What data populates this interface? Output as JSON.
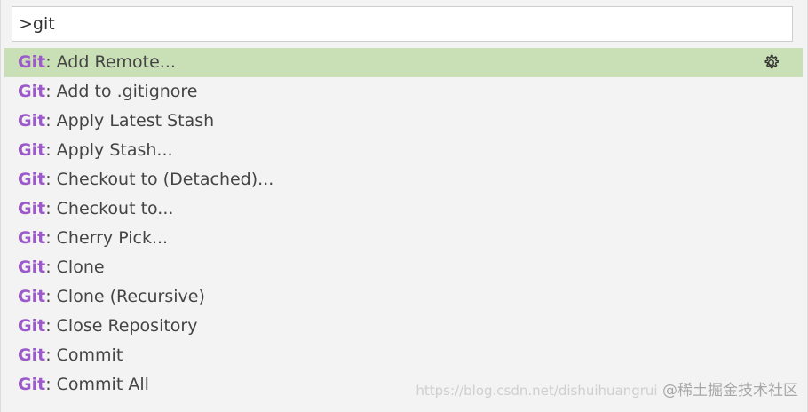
{
  "quick_open": {
    "input_value": ">git",
    "items": [
      {
        "prefix": "Git",
        "label": ": Add Remote...",
        "selected": true
      },
      {
        "prefix": "Git",
        "label": ": Add to .gitignore"
      },
      {
        "prefix": "Git",
        "label": ": Apply Latest Stash"
      },
      {
        "prefix": "Git",
        "label": ": Apply Stash..."
      },
      {
        "prefix": "Git",
        "label": ": Checkout to (Detached)..."
      },
      {
        "prefix": "Git",
        "label": ": Checkout to..."
      },
      {
        "prefix": "Git",
        "label": ": Cherry Pick..."
      },
      {
        "prefix": "Git",
        "label": ": Clone"
      },
      {
        "prefix": "Git",
        "label": ": Clone (Recursive)"
      },
      {
        "prefix": "Git",
        "label": ": Close Repository"
      },
      {
        "prefix": "Git",
        "label": ": Commit"
      },
      {
        "prefix": "Git",
        "label": ": Commit All"
      }
    ],
    "selected_icon": "gear-icon"
  },
  "watermark": {
    "url": "https://blog.csdn.net/dishuihuangrui",
    "text": "@稀土掘金技术社区"
  },
  "colors": {
    "highlight_prefix": "#9b59c9",
    "selected_background": "#c9dfb6",
    "list_background": "#f3f3f3"
  }
}
